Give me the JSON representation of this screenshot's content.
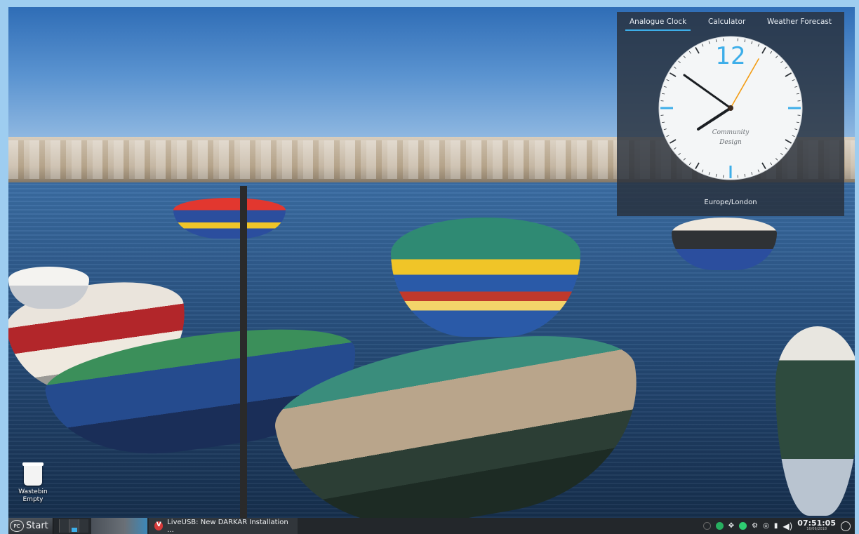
{
  "widget": {
    "tabs": [
      {
        "label": "Analogue Clock",
        "active": true
      },
      {
        "label": "Calculator",
        "active": false
      },
      {
        "label": "Weather Forecast",
        "active": false
      }
    ],
    "clock": {
      "twelve": "12",
      "brand_line1": "Community",
      "brand_line2": "Design",
      "time_shown": "07:51:05"
    },
    "timezone": "Europe/London"
  },
  "desktop": {
    "trash": {
      "label1": "Wastebin",
      "label2": "Empty"
    }
  },
  "taskbar": {
    "start_label": "Start",
    "start_logo": "PC",
    "task_label": "LiveUSB: New DARKAR Installation ...",
    "time": "07:51:05",
    "date": "16/06/2018"
  },
  "colors": {
    "accent": "#3daee9",
    "second_hand": "#f39c12",
    "widget_bg": "#28303a",
    "taskbar_bg": "#23272b"
  },
  "icons": [
    "kde-start-icon",
    "vivaldi-icon",
    "trash-icon",
    "network-icon",
    "dropbox-icon",
    "update-icon",
    "bluetooth-icon",
    "usb-icon",
    "volume-icon",
    "power-icon"
  ]
}
